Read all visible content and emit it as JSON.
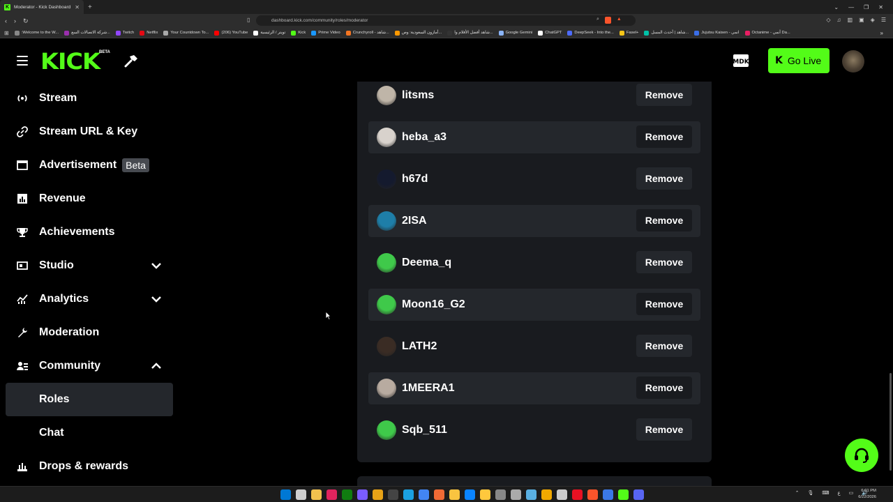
{
  "browser": {
    "tab_title": "Moderator - Kick Dashboard",
    "url": "dashboard.kick.com/community/roles/moderator",
    "bookmarks": [
      {
        "label": ":Welcome to the W...",
        "color": "#888"
      },
      {
        "label": "شركة الاتصالات السع...",
        "color": "#9b2fae"
      },
      {
        "label": "Twitch",
        "color": "#9146ff"
      },
      {
        "label": "Netflix",
        "color": "#e50914"
      },
      {
        "label": "Your Countdown To...",
        "color": "#aaaaaa"
      },
      {
        "label": "(206) YouTube",
        "color": "#ff0000"
      },
      {
        "label": "تويتر / الرئيسية",
        "color": "#ffffff"
      },
      {
        "label": "Kick",
        "color": "#53fc18"
      },
      {
        "label": "Prime Video",
        "color": "#1a98ff"
      },
      {
        "label": "Crunchyroll - شاهد...",
        "color": "#f47521"
      },
      {
        "label": "أمازون السعودية: وص...",
        "color": "#ff9900"
      },
      {
        "label": "شاهد أفضل الأفلام وا...",
        "color": "#333333"
      },
      {
        "label": "Google Gemini",
        "color": "#8ab4f8"
      },
      {
        "label": "ChatGPT",
        "color": "#ffffff"
      },
      {
        "label": "DeepSeek - Into the...",
        "color": "#4d6bfe"
      },
      {
        "label": "Fasel+",
        "color": "#f5c518"
      },
      {
        "label": "شاهد | أحدث المسل...",
        "color": "#00c2a8"
      },
      {
        "label": "Jujutsu Kaisen - انمي",
        "color": "#3a6ee8"
      },
      {
        "label": "Octanime - أنمي Da...",
        "color": "#e91e63"
      }
    ]
  },
  "header": {
    "logo": "KICK",
    "logo_badge": "BETA",
    "go_live_label": "Go Live",
    "icons": {
      "menu": "hamburger-icon",
      "tools": "hammer-icon",
      "mdk": "mdk-logo-icon",
      "support": "headset-icon"
    }
  },
  "sidebar": {
    "items": [
      {
        "label": "Stream",
        "icon": "broadcast-icon"
      },
      {
        "label": "Stream URL & Key",
        "icon": "link-icon"
      },
      {
        "label": "Advertisement",
        "badge": "Beta",
        "icon": "browser-window-icon"
      },
      {
        "label": "Revenue",
        "icon": "bar-chart-icon"
      },
      {
        "label": "Achievements",
        "icon": "trophy-icon"
      },
      {
        "label": "Studio",
        "icon": "studio-icon",
        "expandable": true
      },
      {
        "label": "Analytics",
        "icon": "analytics-icon",
        "expandable": true
      },
      {
        "label": "Moderation",
        "icon": "wrench-icon"
      },
      {
        "label": "Community",
        "icon": "users-icon",
        "expanded": true
      },
      {
        "label": "Roles",
        "sub": true,
        "active": true
      },
      {
        "label": "Chat",
        "sub": true
      },
      {
        "label": "Drops & rewards",
        "icon": "drops-icon"
      }
    ]
  },
  "moderators": {
    "remove_label": "Remove",
    "users": [
      {
        "name": "litsms",
        "avatar_color": "#bfb5a8"
      },
      {
        "name": "heba_a3",
        "avatar_color": "#d8d2cc"
      },
      {
        "name": "h67d",
        "avatar_color": "#141a2e"
      },
      {
        "name": "2ISA",
        "avatar_color": "#1e7ea8"
      },
      {
        "name": "Deema_q",
        "avatar_color": "#3fc94a"
      },
      {
        "name": "Moon16_G2",
        "avatar_color": "#3fc94a"
      },
      {
        "name": "LATH2",
        "avatar_color": "#3a2c24"
      },
      {
        "name": "1MEERA1",
        "avatar_color": "#b8aba0"
      },
      {
        "name": "Sqb_511",
        "avatar_color": "#3fc94a"
      }
    ]
  },
  "taskbar": {
    "time": "6:01 PM",
    "date": "6/22/2026",
    "lang": "ع"
  }
}
